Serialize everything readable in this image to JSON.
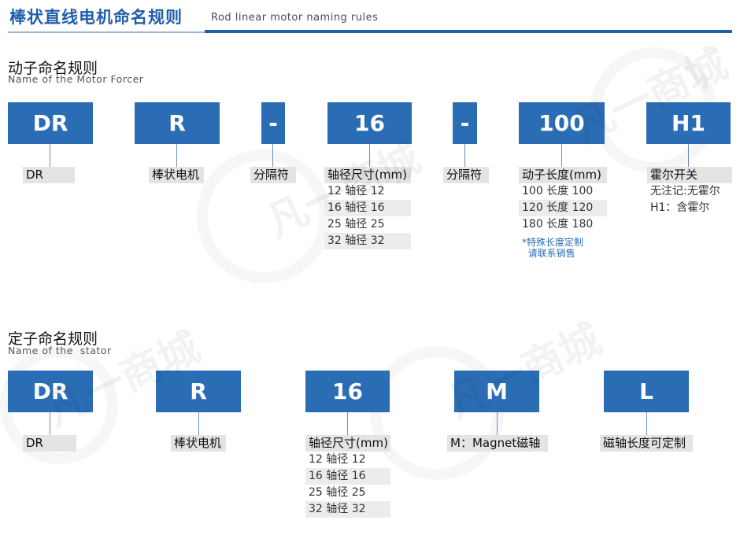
{
  "header": {
    "title": "棒状直线电机命名规则",
    "subtitle": "Rod linear motor naming rules"
  },
  "watermark": {
    "text": "凡一商城"
  },
  "forcer": {
    "title": "动子命名规则",
    "subtitle": "Name of the Motor Forcer",
    "codes": [
      "DR",
      "R",
      "-",
      "16",
      "-",
      "100",
      "H1"
    ],
    "legends": {
      "dr": "DR",
      "r": "棒状电机",
      "sep1": "分隔符",
      "diameter": {
        "head": "轴径尺寸(mm)",
        "rows": [
          "12 轴径 12",
          "16 轴径 16",
          "25 轴径 25",
          "32 轴径 32"
        ]
      },
      "sep2": "分隔符",
      "length": {
        "head": "动子长度(mm)",
        "rows": [
          "100 长度 100",
          "120 长度 120",
          "180 长度 180"
        ]
      },
      "length_note": "*特殊长度定制\n  请联系销售",
      "hall": {
        "head": "霍尔开关",
        "rows": [
          "无注记:无霍尔",
          "H1：含霍尔"
        ]
      }
    }
  },
  "stator": {
    "title": "定子命名规则",
    "subtitle": "Name of the  stator",
    "codes": [
      "DR",
      "R",
      "16",
      "M",
      "L"
    ],
    "legends": {
      "dr": "DR",
      "r": "棒状电机",
      "diameter": {
        "head": "轴径尺寸(mm)",
        "rows": [
          "12 轴径 12",
          "16 轴径 16",
          "25 轴径 25",
          "32 轴径 32"
        ]
      },
      "magnet": "M：Magnet磁轴",
      "length": "磁轴长度可定制"
    }
  },
  "colors": {
    "brand_blue": "#2a6db5",
    "title_blue": "#1f5fa8",
    "legend_gray": "#e4e4e4"
  }
}
